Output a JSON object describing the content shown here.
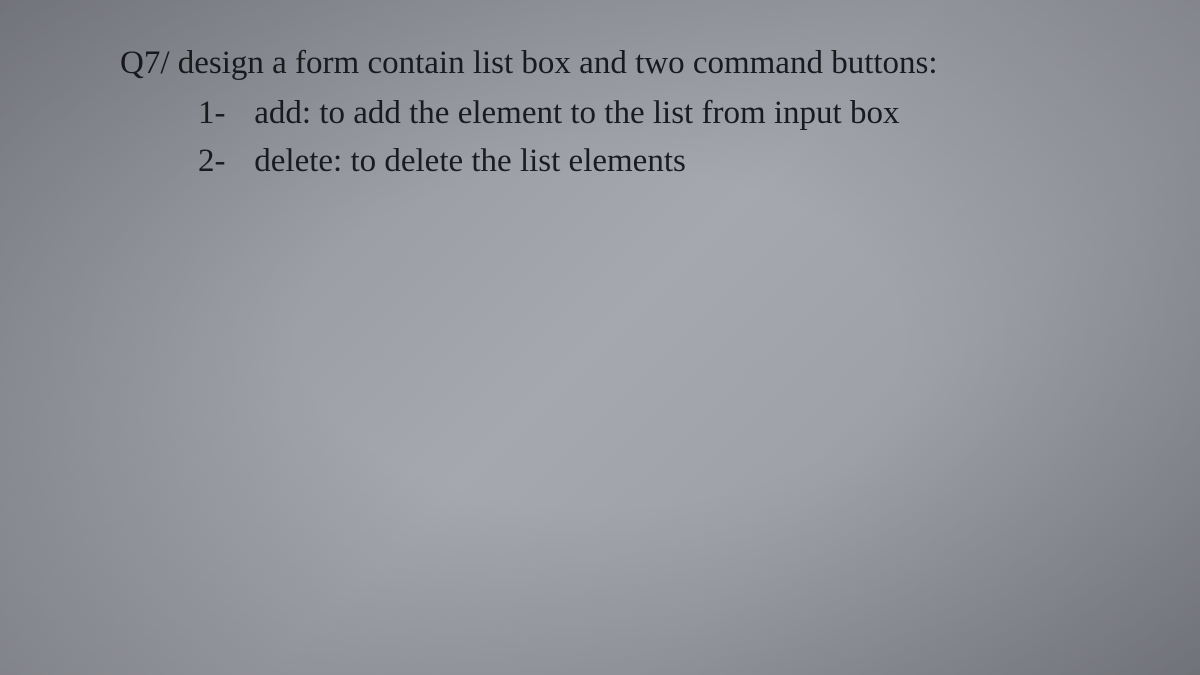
{
  "question": {
    "label": "Q7/",
    "intro": "design a form contain list box and two command buttons:",
    "items": [
      {
        "num": "1-",
        "text": "add: to add the element to the list from input box"
      },
      {
        "num": "2-",
        "text": "delete: to delete the list elements"
      }
    ]
  }
}
